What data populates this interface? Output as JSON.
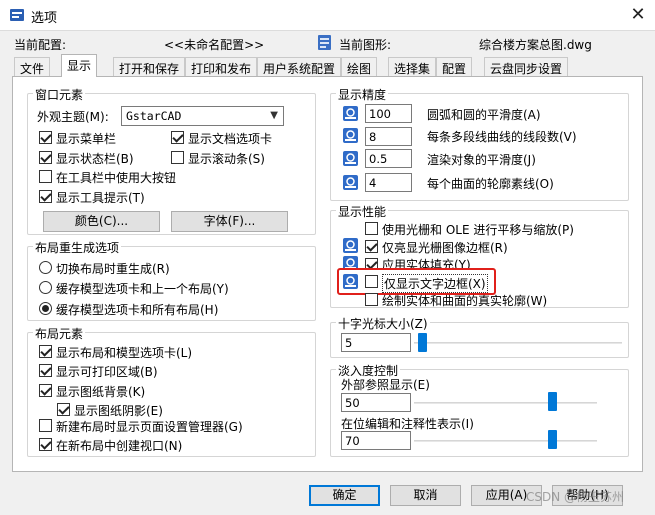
{
  "window": {
    "title": "选项",
    "close_glyph": "✕"
  },
  "header": {
    "profile_label": "当前配置:",
    "profile_value": "<<未命名配置>>",
    "drawing_label": "当前图形:",
    "drawing_value": "综合楼方案总图.dwg"
  },
  "tabs": [
    {
      "label": "文件"
    },
    {
      "label": "显示",
      "active": true
    },
    {
      "label": "打开和保存"
    },
    {
      "label": "打印和发布"
    },
    {
      "label": "用户系统配置"
    },
    {
      "label": "绘图"
    },
    {
      "label": "选择集"
    },
    {
      "label": "配置"
    },
    {
      "label": "云盘同步设置"
    }
  ],
  "window_elements": {
    "title": "窗口元素",
    "theme_label": "外观主题(M):",
    "theme_value": "GstarCAD",
    "checkboxes": [
      {
        "label": "显示菜单栏",
        "checked": true
      },
      {
        "label": "显示文档选项卡",
        "checked": true
      },
      {
        "label": "显示状态栏(B)",
        "checked": true
      },
      {
        "label": "显示滚动条(S)",
        "checked": false
      },
      {
        "label": "在工具栏中使用大按钮",
        "checked": false
      },
      {
        "label": "显示工具提示(T)",
        "checked": true
      }
    ],
    "colors_button": "颜色(C)...",
    "fonts_button": "字体(F)..."
  },
  "layout_regen": {
    "title": "布局重生成选项",
    "options": [
      {
        "label": "切换布局时重生成(R)",
        "selected": false
      },
      {
        "label": "缓存模型选项卡和上一个布局(Y)",
        "selected": false
      },
      {
        "label": "缓存模型选项卡和所有布局(H)",
        "selected": true
      }
    ]
  },
  "layout_elements": {
    "title": "布局元素",
    "checkboxes": [
      {
        "label": "显示布局和模型选项卡(L)",
        "checked": true
      },
      {
        "label": "显示可打印区域(B)",
        "checked": true
      },
      {
        "label": "显示图纸背景(K)",
        "checked": true
      },
      {
        "label": "显示图纸阴影(E)",
        "checked": true
      },
      {
        "label": "新建布局时显示页面设置管理器(G)",
        "checked": false
      },
      {
        "label": "在新布局中创建视口(N)",
        "checked": true
      }
    ]
  },
  "display_resolution": {
    "title": "显示精度",
    "rows": [
      {
        "value": "100",
        "label": "圆弧和圆的平滑度(A)"
      },
      {
        "value": "8",
        "label": "每条多段线曲线的线段数(V)"
      },
      {
        "value": "0.5",
        "label": "渲染对象的平滑度(J)"
      },
      {
        "value": "4",
        "label": "每个曲面的轮廓素线(O)"
      }
    ]
  },
  "display_performance": {
    "title": "显示性能",
    "checkboxes": [
      {
        "label": "使用光栅和 OLE 进行平移与缩放(P)",
        "checked": false
      },
      {
        "label": "仅亮显光栅图像边框(R)",
        "checked": true
      },
      {
        "label": "应用实体填充(Y)",
        "checked": true
      },
      {
        "label": "仅显示文字边框(X)",
        "checked": false
      },
      {
        "label": "绘制实体和曲面的真实轮廓(W)",
        "checked": false
      }
    ],
    "highlight_color": "#e0201b"
  },
  "crosshair": {
    "title": "十字光标大小(Z)",
    "value": "5",
    "level_percent": 5
  },
  "fade_control": {
    "title": "淡入度控制",
    "xref_label": "外部参照显示(E)",
    "xref_value": "50",
    "xref_level_percent": 90,
    "inplace_label": "在位编辑和注释性表示(I)",
    "inplace_value": "70",
    "inplace_level_percent": 90
  },
  "footer": {
    "ok": "确定",
    "cancel": "取消",
    "apply": "应用(A)",
    "help": "帮助(H)",
    "watermark": "CSDN @杨玉苏州"
  },
  "colors": {
    "accent": "#0078d7",
    "highlight": "#e0201b"
  }
}
